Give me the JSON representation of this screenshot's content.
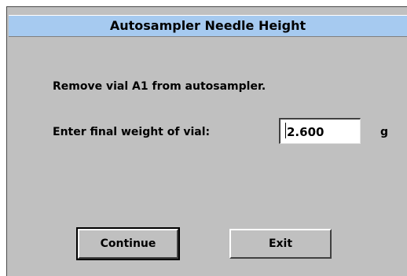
{
  "dialog": {
    "title": "Autosampler Needle Height",
    "message": "Remove vial A1 from autosampler.",
    "weight_label": "Enter final weight of vial:",
    "weight_value": "2.600",
    "weight_unit": "g",
    "continue_label": "Continue",
    "exit_label": "Exit"
  },
  "colors": {
    "dialog_background": "#c0c0c0",
    "titlebar_background": "#a6caf0"
  }
}
